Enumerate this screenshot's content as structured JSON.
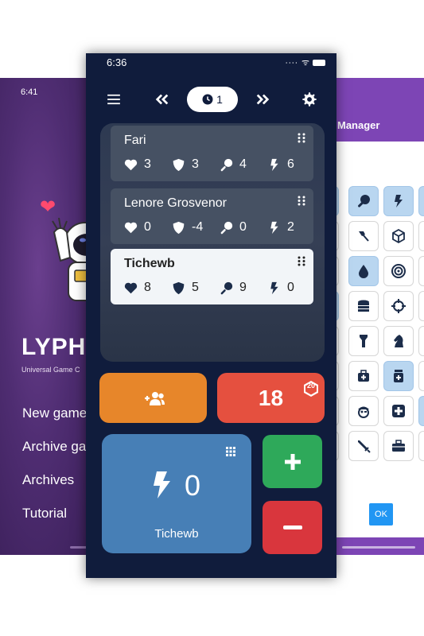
{
  "left_screen": {
    "time": "6:41",
    "logo": "LYPH",
    "tagline": "Universal Game C",
    "menu": [
      "New game",
      "Archive ga",
      "Archives",
      "Tutorial"
    ]
  },
  "right_screen": {
    "title": "Manager",
    "ok_label": "OK",
    "icons": [
      "paddle-icon",
      "bolt-icon",
      "axe-icon",
      "cube-icon",
      "drop-icon",
      "target-icon",
      "coins-icon",
      "crosshair-icon",
      "flashlight-icon",
      "knight-icon",
      "medkit-icon",
      "bottle-icon",
      "pirate-icon",
      "plus-box-icon",
      "sword-icon",
      "toolbox-icon"
    ]
  },
  "phone": {
    "time": "6:36",
    "turn_number": "1",
    "players": [
      {
        "name": "Fari",
        "life": "3",
        "armor": "3",
        "weapon": "4",
        "energy": "6"
      },
      {
        "name": "Lenore Grosvenor",
        "life": "0",
        "armor": "-4",
        "weapon": "0",
        "energy": "2"
      },
      {
        "name": "Tichewb",
        "life": "8",
        "armor": "5",
        "weapon": "9",
        "energy": "0"
      }
    ],
    "die": {
      "result": "18",
      "sides": "20"
    },
    "counter": {
      "value": "0",
      "player": "Tichewb",
      "icon": "bolt-icon"
    }
  },
  "colors": {
    "phone_bg": "#101c3c",
    "add_button": "#e7862a",
    "die_button": "#e5503f",
    "counter_bg": "#477fb6",
    "plus_button": "#2ea95a",
    "minus_button": "#d9363d",
    "purple": "#7d45b5"
  }
}
